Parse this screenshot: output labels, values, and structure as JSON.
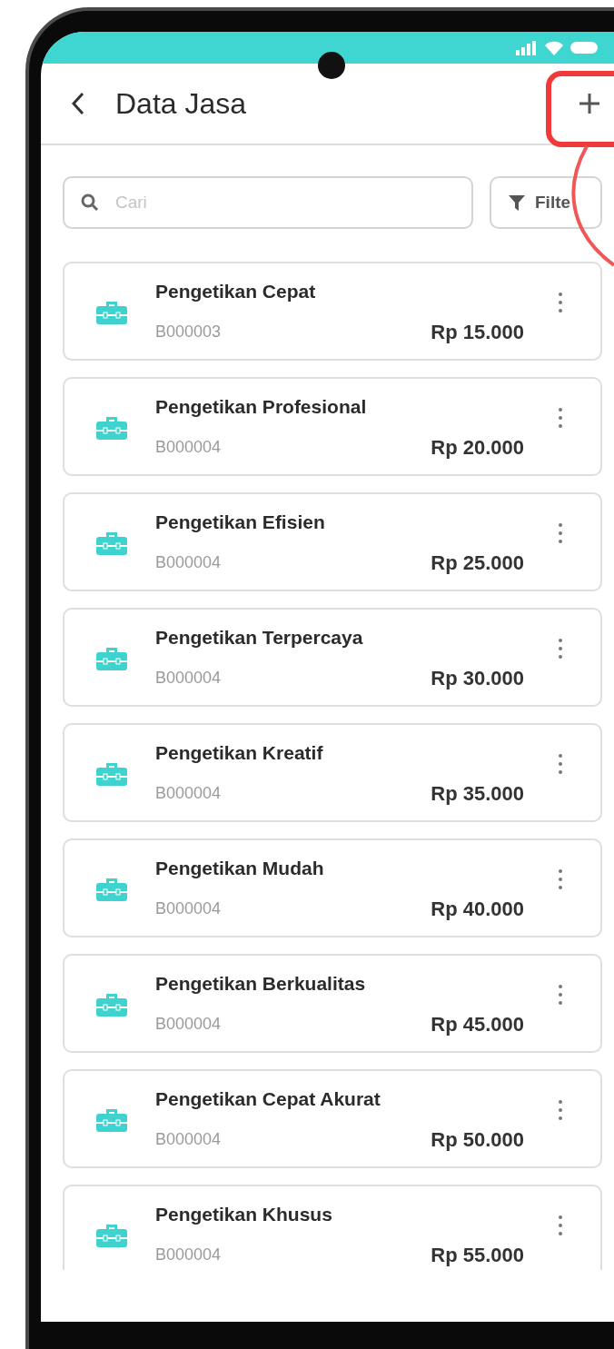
{
  "header": {
    "title": "Data Jasa"
  },
  "search": {
    "placeholder": "Cari"
  },
  "filter_button": {
    "label": "Filte"
  },
  "services": [
    {
      "name": "Pengetikan Cepat",
      "code": "B000003",
      "price": "Rp 15.000"
    },
    {
      "name": "Pengetikan Profesional",
      "code": "B000004",
      "price": "Rp 20.000"
    },
    {
      "name": "Pengetikan Efisien",
      "code": "B000004",
      "price": "Rp 25.000"
    },
    {
      "name": "Pengetikan Terpercaya",
      "code": "B000004",
      "price": "Rp 30.000"
    },
    {
      "name": "Pengetikan Kreatif",
      "code": "B000004",
      "price": "Rp 35.000"
    },
    {
      "name": "Pengetikan Mudah",
      "code": "B000004",
      "price": "Rp 40.000"
    },
    {
      "name": "Pengetikan Berkualitas",
      "code": "B000004",
      "price": "Rp 45.000"
    },
    {
      "name": "Pengetikan Cepat Akurat",
      "code": "B000004",
      "price": "Rp 50.000"
    },
    {
      "name": "Pengetikan Khusus",
      "code": "B000004",
      "price": "Rp 55.000"
    }
  ]
}
